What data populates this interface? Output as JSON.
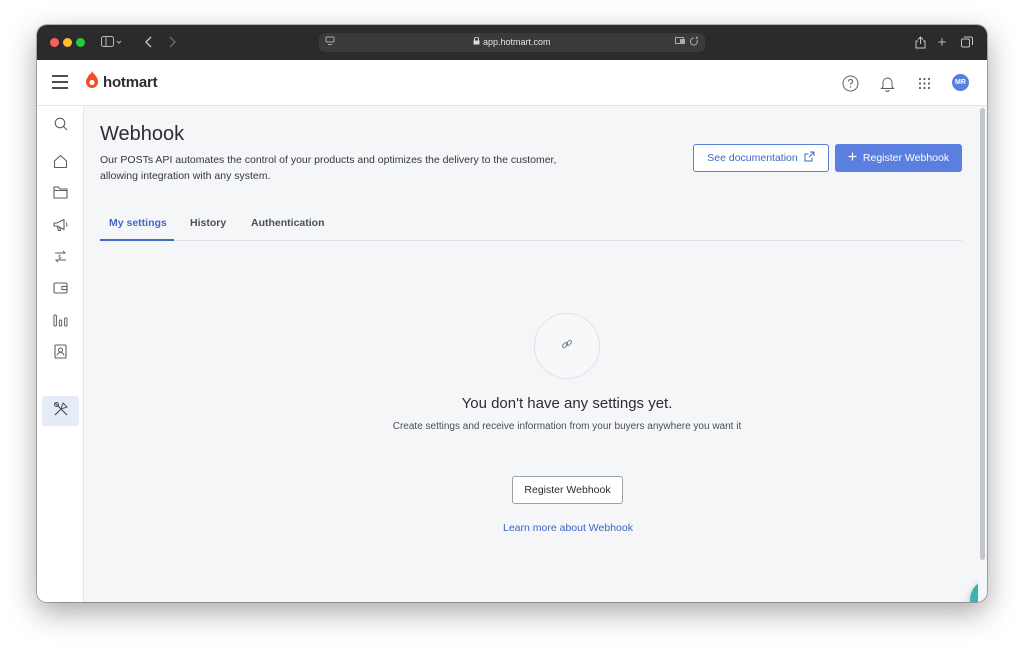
{
  "browser": {
    "url": "app.hotmart.com"
  },
  "header": {
    "brand": "hotmart",
    "avatar_initials": "MR"
  },
  "page": {
    "title": "Webhook",
    "description": "Our POSTs API automates the control of your products and optimizes the delivery to the customer, allowing integration with any system.",
    "see_docs_label": "See documentation",
    "register_label": "Register Webhook"
  },
  "tabs": [
    {
      "label": "My settings",
      "active": true
    },
    {
      "label": "History",
      "active": false
    },
    {
      "label": "Authentication",
      "active": false
    }
  ],
  "empty_state": {
    "title": "You don't have any settings yet.",
    "subtitle": "Create settings and receive information from your buyers anywhere you want it",
    "button_label": "Register Webhook",
    "link_label": "Learn more about Webhook"
  },
  "sidebar": {
    "items": [
      {
        "icon": "search-icon"
      },
      {
        "icon": "home-icon"
      },
      {
        "icon": "folder-icon"
      },
      {
        "icon": "megaphone-icon"
      },
      {
        "icon": "money-transfer-icon"
      },
      {
        "icon": "wallet-icon"
      },
      {
        "icon": "bar-chart-icon"
      },
      {
        "icon": "contact-card-icon"
      },
      {
        "icon": "tools-icon",
        "active": true
      }
    ]
  },
  "colors": {
    "accent": "#5a7fde",
    "link": "#3f64c8",
    "brand": "#ef4e23",
    "chat": "#3bb3ae"
  }
}
